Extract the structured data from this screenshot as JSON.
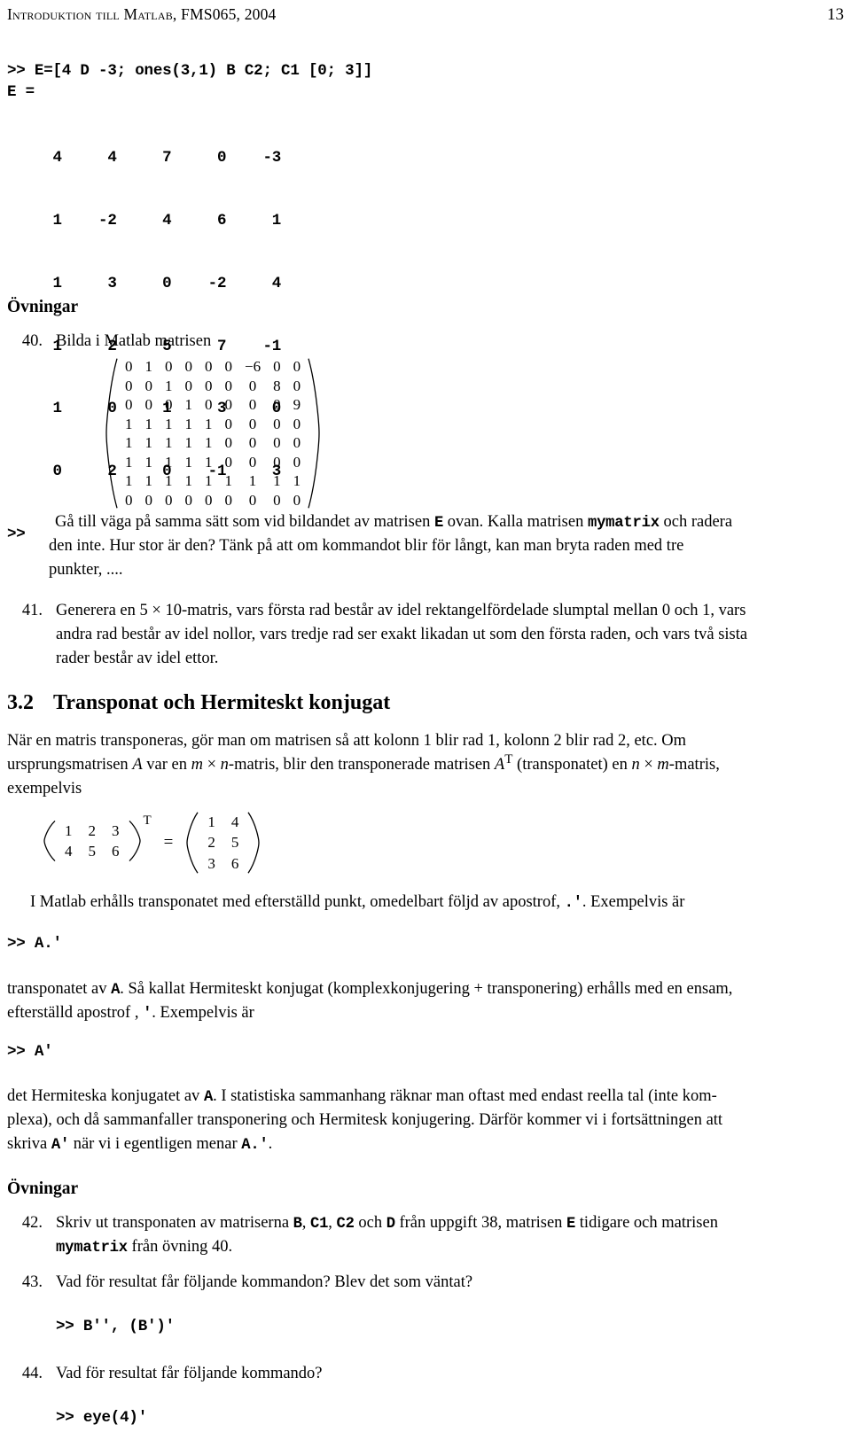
{
  "header": {
    "title": "Introduktion till Matlab, FMS065, 2004",
    "page_number": "13"
  },
  "matlab_session": {
    "command": ">> E=[4 D -3; ones(3,1) B C2; C1 [0; 3]]",
    "result_label": "E =",
    "matrix_rows": [
      "     4     4     7     0    -3",
      "     1    -2     4     6     1",
      "     1     3     0    -2     4",
      "     1     2     5     7    -1",
      "     1     0     1     3     0",
      "     0     2     0    -1     3"
    ],
    "prompt": ">>"
  },
  "exercises_heading_1": "Övningar",
  "exercise_40": {
    "number": "40.",
    "intro": "Bilda i Matlab matrisen",
    "matrix": [
      [
        "0",
        "1",
        "0",
        "0",
        "0",
        "0",
        "−6",
        "0",
        "0"
      ],
      [
        "0",
        "0",
        "1",
        "0",
        "0",
        "0",
        "0",
        "8",
        "0"
      ],
      [
        "0",
        "0",
        "0",
        "1",
        "0",
        "0",
        "0",
        "0",
        "9"
      ],
      [
        "1",
        "1",
        "1",
        "1",
        "1",
        "0",
        "0",
        "0",
        "0"
      ],
      [
        "1",
        "1",
        "1",
        "1",
        "1",
        "0",
        "0",
        "0",
        "0"
      ],
      [
        "1",
        "1",
        "1",
        "1",
        "1",
        "0",
        "0",
        "0",
        "0"
      ],
      [
        "1",
        "1",
        "1",
        "1",
        "1",
        "1",
        "1",
        "1",
        "1"
      ],
      [
        "0",
        "0",
        "0",
        "0",
        "0",
        "0",
        "0",
        "0",
        "0"
      ]
    ],
    "body_line_1_a": "Gå till väga på samma sätt som vid bildandet av matrisen ",
    "body_code_E": "E",
    "body_line_1_b": " ovan. Kalla matrisen ",
    "body_code_mymatrix": "mymatrix",
    "body_line_1_c": " och radera",
    "body_line_2": "den inte. Hur stor är den? Tänk på att om kommandot blir för långt, kan man bryta raden med tre",
    "body_line_3": "punkter, ...."
  },
  "exercise_41": {
    "number": "41.",
    "line_1_a": "Generera en 5 ",
    "times": "×",
    "line_1_b": " 10-matris, vars första rad består av idel rektangelfördelade slumptal mellan 0 och 1, vars",
    "line_2": "andra rad består av idel nollor, vars tredje rad ser exakt likadan ut som den första raden, och vars två sista",
    "line_3": "rader består av idel ettor."
  },
  "section": {
    "number": "3.2",
    "title": "Transponat och Hermiteskt konjugat",
    "para_1_line1": "När en matris transponeras, gör man om matrisen så att kolonn 1 blir rad 1, kolonn 2 blir rad 2, etc. Om",
    "para_1_line2_a": "ursprungsmatrisen ",
    "para_1_A": "A",
    "para_1_line2_b": " var en ",
    "para_1_m": "m",
    "para_1_line2_c": " × ",
    "para_1_n": "n",
    "para_1_line2_d": "-matris, blir den transponerade matrisen ",
    "para_1_AT": "A",
    "para_1_T": "T",
    "para_1_line2_e": " (transponatet) en ",
    "para_1_n2": "n",
    "para_1_line2_f": " × ",
    "para_1_m2": "m",
    "para_1_line2_g": "-matris,",
    "para_1_line3": "exempelvis"
  },
  "transpose_equation": {
    "lhs": [
      [
        "1",
        "2",
        "3"
      ],
      [
        "4",
        "5",
        "6"
      ]
    ],
    "lhs_exponent": "T",
    "equals": "=",
    "rhs": [
      [
        "1",
        "4"
      ],
      [
        "2",
        "5"
      ],
      [
        "3",
        "6"
      ]
    ]
  },
  "transpose_text": {
    "line_1_a": "I Matlab erhålls transponatet med efterställd punkt, omedelbart följd av apostrof, ",
    "code_dotapos": ".'",
    "line_1_b": ". Exempelvis är"
  },
  "code_A_dot_apos": ">> A.'",
  "hermitean_text": {
    "line_1_a": "transponatet av ",
    "code_A": "A",
    "line_1_b": ". Så kallat Hermiteskt konjugat (komplexkonjugering + transponering) erhålls med en ensam,",
    "line_2_a": "efterställd apostrof , ",
    "code_apos": "'",
    "line_2_b": ". Exempelvis är"
  },
  "code_A_apos": ">> A'",
  "hermitean_para_2": {
    "line_1_a": "det Hermiteska konjugatet av ",
    "code_A": "A",
    "line_1_b": ". I statistiska sammanhang räknar man oftast med endast reella tal (inte kom-",
    "line_2": "plexa), och då sammanfaller transponering och Hermitesk konjugering. Därför kommer vi i fortsättningen att",
    "line_3_a": "skriva ",
    "code_Aapos": "A'",
    "line_3_b": " när vi i egentligen menar ",
    "code_Adotapos": "A.'",
    "line_3_c": "."
  },
  "exercises_heading_2": "Övningar",
  "exercise_42": {
    "number": "42.",
    "line_1_a": "Skriv ut transponaten av matriserna ",
    "code_B": "B",
    "sep_1": ", ",
    "code_C1": "C1",
    "sep_2": ", ",
    "code_C2": "C2",
    "line_1_b": " och ",
    "code_D": "D",
    "line_1_c": " från uppgift 38, matrisen ",
    "code_E": "E",
    "line_1_d": " tidigare och matrisen",
    "line_2_a": "",
    "code_mymatrix": "mymatrix",
    "line_2_b": " från övning 40."
  },
  "exercise_43": {
    "number": "43.",
    "text": "Vad för resultat får följande kommandon? Blev det som väntat?",
    "code": ">> B'', (B')'"
  },
  "exercise_44": {
    "number": "44.",
    "text": "Vad för resultat får följande kommando?",
    "code": ">> eye(4)'"
  }
}
